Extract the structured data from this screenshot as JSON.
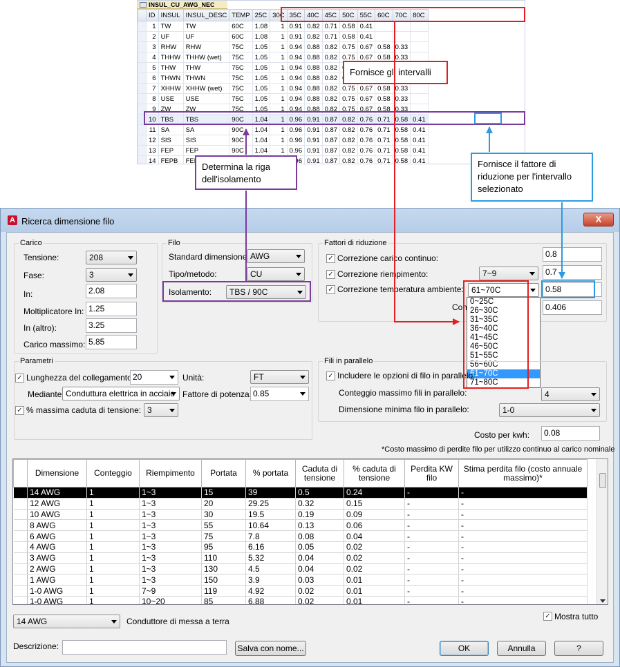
{
  "table": {
    "tab_name": "INSUL_CU_AWG_NEC",
    "columns": [
      "ID",
      "INSUL",
      "INSUL_DESC",
      "TEMP",
      "25C",
      "30C",
      "35C",
      "40C",
      "45C",
      "50C",
      "55C",
      "60C",
      "70C",
      "80C"
    ],
    "rows": [
      [
        "1",
        "TW",
        "TW",
        "60C",
        "1.08",
        "1",
        "0.91",
        "0.82",
        "0.71",
        "0.58",
        "0.41",
        "",
        "",
        ""
      ],
      [
        "2",
        "UF",
        "UF",
        "60C",
        "1.08",
        "1",
        "0.91",
        "0.82",
        "0.71",
        "0.58",
        "0.41",
        "",
        "",
        ""
      ],
      [
        "3",
        "RHW",
        "RHW",
        "75C",
        "1.05",
        "1",
        "0.94",
        "0.88",
        "0.82",
        "0.75",
        "0.67",
        "0.58",
        "0.33",
        ""
      ],
      [
        "4",
        "THHW",
        "THHW (wet)",
        "75C",
        "1.05",
        "1",
        "0.94",
        "0.88",
        "0.82",
        "0.75",
        "0.67",
        "0.58",
        "0.33",
        ""
      ],
      [
        "5",
        "THW",
        "THW",
        "75C",
        "1.05",
        "1",
        "0.94",
        "0.88",
        "0.82",
        "0.75",
        "0.67",
        "0.58",
        "0.33",
        ""
      ],
      [
        "6",
        "THWN",
        "THWN",
        "75C",
        "1.05",
        "1",
        "0.94",
        "0.88",
        "0.82",
        "0.75",
        "0.67",
        "0.58",
        "0.33",
        ""
      ],
      [
        "7",
        "XHHW",
        "XHHW (wet)",
        "75C",
        "1.05",
        "1",
        "0.94",
        "0.88",
        "0.82",
        "0.75",
        "0.67",
        "0.58",
        "0.33",
        ""
      ],
      [
        "8",
        "USE",
        "USE",
        "75C",
        "1.05",
        "1",
        "0.94",
        "0.88",
        "0.82",
        "0.75",
        "0.67",
        "0.58",
        "0.33",
        ""
      ],
      [
        "9",
        "ZW",
        "ZW",
        "75C",
        "1.05",
        "1",
        "0.94",
        "0.88",
        "0.82",
        "0.75",
        "0.67",
        "0.58",
        "0.33",
        ""
      ],
      [
        "10",
        "TBS",
        "TBS",
        "90C",
        "1.04",
        "1",
        "0.96",
        "0.91",
        "0.87",
        "0.82",
        "0.76",
        "0.71",
        "0.58",
        "0.41"
      ],
      [
        "11",
        "SA",
        "SA",
        "90C",
        "1.04",
        "1",
        "0.96",
        "0.91",
        "0.87",
        "0.82",
        "0.76",
        "0.71",
        "0.58",
        "0.41"
      ],
      [
        "12",
        "SIS",
        "SIS",
        "90C",
        "1.04",
        "1",
        "0.96",
        "0.91",
        "0.87",
        "0.82",
        "0.76",
        "0.71",
        "0.58",
        "0.41"
      ],
      [
        "13",
        "FEP",
        "FEP",
        "90C",
        "1.04",
        "1",
        "0.96",
        "0.91",
        "0.87",
        "0.82",
        "0.76",
        "0.71",
        "0.58",
        "0.41"
      ],
      [
        "14",
        "FEPB",
        "FEPB",
        "90C",
        "1.04",
        "1",
        "0.96",
        "0.91",
        "0.87",
        "0.82",
        "0.76",
        "0.71",
        "0.58",
        "0.41"
      ]
    ],
    "highlight_row": 9
  },
  "callouts": {
    "intervals": "Fornisce gli intervalli",
    "row": "Determina la riga dell'isolamento",
    "factor": "Fornisce il fattore di riduzione per l'intervallo selezionato"
  },
  "dialog": {
    "title": "Ricerca dimensione filo",
    "close": "X",
    "load": {
      "legend": "Carico",
      "voltage_label": "Tensione:",
      "voltage": "208",
      "phase_label": "Fase:",
      "phase": "3",
      "in_label": "In:",
      "in": "2.08",
      "mult_label": "Moltiplicatore In:",
      "mult": "1.25",
      "in_other_label": "In (altro):",
      "in_other": "3.25",
      "max_label": "Carico massimo:",
      "max": "5.85"
    },
    "wire": {
      "legend": "Filo",
      "std_label": "Standard dimensione:",
      "std": "AWG",
      "type_label": "Tipo/metodo:",
      "type": "CU",
      "insul_label": "Isolamento:",
      "insul": "TBS / 90C"
    },
    "derating": {
      "legend": "Fattori di riduzione",
      "cont_label": "Correzione carico continuo:",
      "cont": "0.8",
      "fill_label": "Correzione riempimento:",
      "fill_range": "7~9",
      "fill": "0.7",
      "temp_label": "Correzione temperatura ambiente:",
      "temp_range": "61~70C",
      "temp": "0.58",
      "combined_label": "Comb",
      "combined": "0.406",
      "range_options": [
        "0~25C",
        "26~30C",
        "31~35C",
        "36~40C",
        "41~45C",
        "46~50C",
        "51~55C",
        "56~60C",
        "61~70C",
        "71~80C"
      ],
      "range_selected": 8
    },
    "params": {
      "legend": "Parametri",
      "length_label": "Lunghezza del collegamento:",
      "length": "20",
      "unit_label": "Unità:",
      "unit": "FT",
      "via_label": "Mediante:",
      "via": "Conduttura elettrica in acciaio",
      "pf_label": "Fattore di potenza:",
      "pf": "0.85",
      "drop_label": "% massima caduta di tensione:",
      "drop": "3"
    },
    "parallel": {
      "legend": "Fili in parallelo",
      "include_label": "Includere le opzioni di filo in parallelo:",
      "max_label": "Conteggio massimo fili in parallelo:",
      "max": "4",
      "min_label": "Dimensione minima filo in parallelo:",
      "min": "1-0"
    },
    "kwh_label": "Costo per kwh:",
    "kwh": "0.08",
    "note": "*Costo massimo di perdite filo per utilizzo continuo al carico nominale",
    "grid": {
      "headers": [
        "Dimensione",
        "Conteggio",
        "Riempimento",
        "Portata",
        "% portata",
        "Caduta di tensione",
        "% caduta di tensione",
        "Perdita KW filo",
        "Stima perdita filo (costo annuale massimo)*"
      ],
      "rows": [
        [
          "14 AWG",
          "1",
          "1~3",
          "15",
          "39",
          "0.5",
          "0.24",
          "-",
          "-"
        ],
        [
          "12 AWG",
          "1",
          "1~3",
          "20",
          "29.25",
          "0.32",
          "0.15",
          "-",
          "-"
        ],
        [
          "10 AWG",
          "1",
          "1~3",
          "30",
          "19.5",
          "0.19",
          "0.09",
          "-",
          "-"
        ],
        [
          "8 AWG",
          "1",
          "1~3",
          "55",
          "10.64",
          "0.13",
          "0.06",
          "-",
          "-"
        ],
        [
          "6 AWG",
          "1",
          "1~3",
          "75",
          "7.8",
          "0.08",
          "0.04",
          "-",
          "-"
        ],
        [
          "4 AWG",
          "1",
          "1~3",
          "95",
          "6.16",
          "0.05",
          "0.02",
          "-",
          "-"
        ],
        [
          "3 AWG",
          "1",
          "1~3",
          "110",
          "5.32",
          "0.04",
          "0.02",
          "-",
          "-"
        ],
        [
          "2 AWG",
          "1",
          "1~3",
          "130",
          "4.5",
          "0.04",
          "0.02",
          "-",
          "-"
        ],
        [
          "1 AWG",
          "1",
          "1~3",
          "150",
          "3.9",
          "0.03",
          "0.01",
          "-",
          "-"
        ],
        [
          "1-0 AWG",
          "1",
          "7~9",
          "119",
          "4.92",
          "0.02",
          "0.01",
          "-",
          "-"
        ],
        [
          "1-0 AWG",
          "1",
          "10~20",
          "85",
          "6.88",
          "0.02",
          "0.01",
          "-",
          "-"
        ]
      ]
    },
    "ground_value": "14 AWG",
    "ground_label": "Conduttore di messa a terra",
    "show_all": "Mostra tutto",
    "desc_label": "Descrizione:",
    "desc": "",
    "save_as": "Salva con nome...",
    "ok": "OK",
    "cancel": "Annulla",
    "help": "?"
  }
}
